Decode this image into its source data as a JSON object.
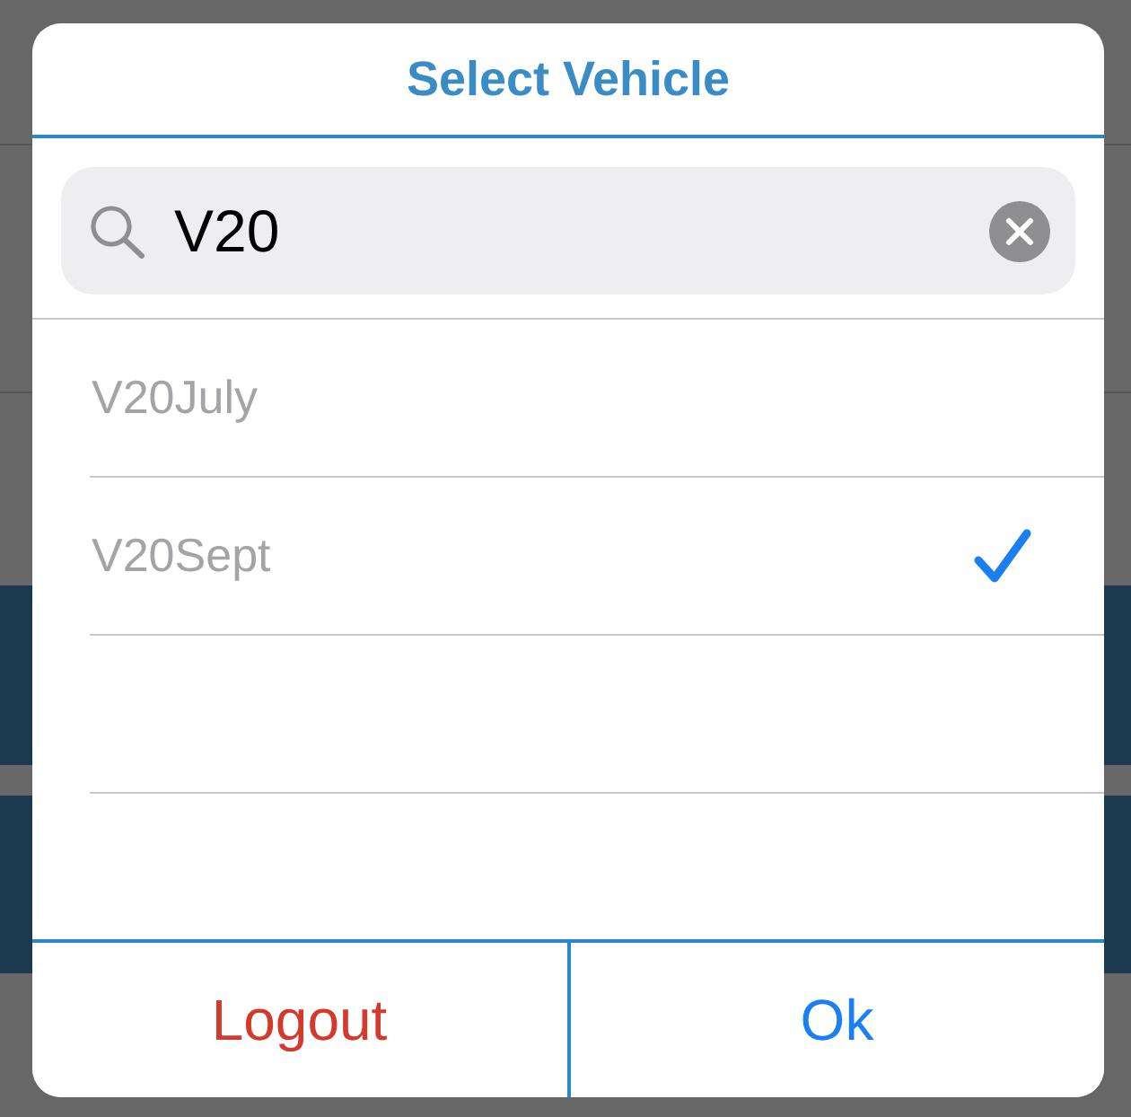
{
  "dialog": {
    "title": "Select Vehicle",
    "search": {
      "value": "V20"
    },
    "options": [
      {
        "label": "V20July",
        "selected": false
      },
      {
        "label": "V20Sept",
        "selected": true
      }
    ],
    "buttons": [
      {
        "label": "Logout",
        "kind": "destructive"
      },
      {
        "label": "Ok",
        "kind": "default"
      }
    ]
  }
}
